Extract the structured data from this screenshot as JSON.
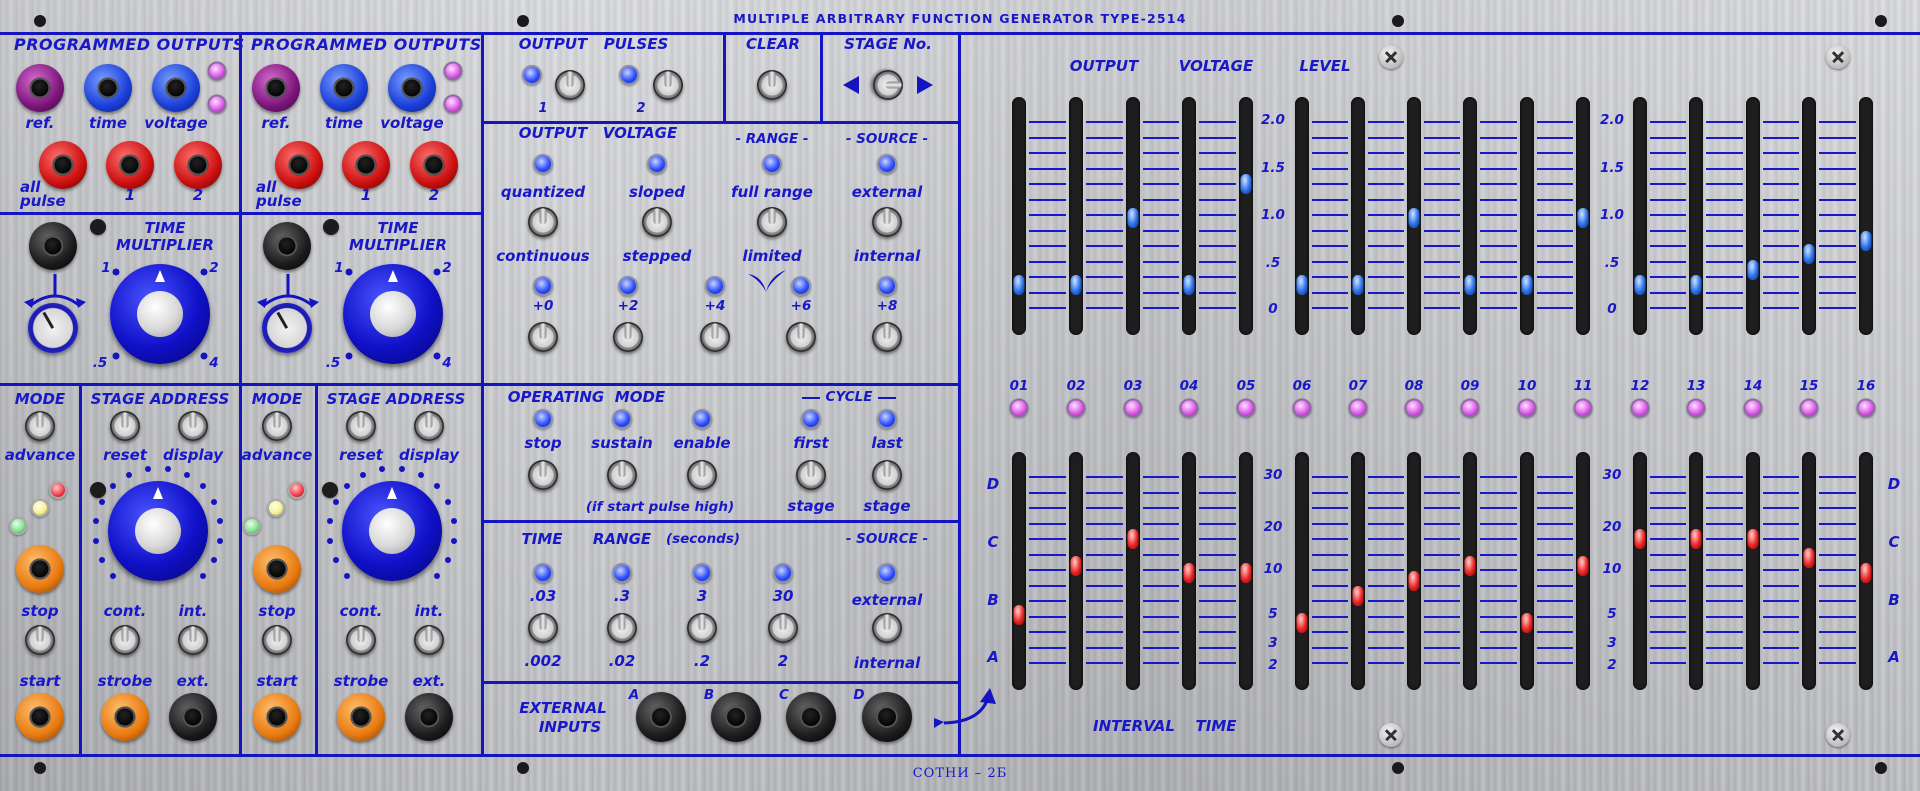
{
  "header": {
    "title": "MULTIPLE ARBITRARY FUNCTION GENERATOR TYPE-2514"
  },
  "footer": {
    "brand": "СОТНИ – 2Б"
  },
  "programmed_outputs": {
    "title": "PROGRAMMED OUTPUTS",
    "ref": "ref.",
    "time": "time",
    "voltage": "voltage",
    "all": "all",
    "pulse": "pulse",
    "one": "1",
    "two": "2"
  },
  "time_multiplier": {
    "title_line1": "TIME",
    "title_line2": "MULTIPLIER",
    "s1": "1",
    "s2": "2",
    "s5": ".5",
    "s4": "4"
  },
  "mode": {
    "title": "MODE",
    "advance": "advance",
    "stop": "stop",
    "start": "start"
  },
  "stage_address": {
    "title": "STAGE ADDRESS",
    "reset": "reset",
    "display": "display",
    "cont": "cont.",
    "int": "int.",
    "strobe": "strobe",
    "ext": "ext."
  },
  "output_pulses": {
    "output": "OUTPUT",
    "pulses": "PULSES",
    "p1": "1",
    "p2": "2"
  },
  "clear": {
    "title": "CLEAR"
  },
  "stage_no": {
    "title": "STAGE No."
  },
  "output_voltage": {
    "output": "OUTPUT",
    "voltage": "VOLTAGE",
    "range": "- RANGE -",
    "source": "- SOURCE -",
    "quantized": "quantized",
    "continuous": "continuous",
    "sloped": "sloped",
    "stepped": "stepped",
    "full_range": "full range",
    "limited": "limited",
    "external": "external",
    "internal": "internal",
    "offsets": [
      "+0",
      "+2",
      "+4",
      "+6",
      "+8"
    ]
  },
  "operating_mode": {
    "operating": "OPERATING",
    "mode": "MODE",
    "cycle": "CYCLE",
    "stop": "stop",
    "sustain": "sustain",
    "enable": "enable",
    "first": "first",
    "last": "last",
    "if_start": "(if start  pulse  high)",
    "stage1": "stage",
    "stage2": "stage"
  },
  "time_range": {
    "time": "TIME",
    "range": "RANGE",
    "seconds": "(seconds)",
    "source": "- SOURCE -",
    "tops": [
      ".03",
      ".3",
      "3",
      "30"
    ],
    "bottoms": [
      ".002",
      ".02",
      ".2",
      "2"
    ],
    "external": "external",
    "internal": "internal"
  },
  "external_inputs": {
    "line1": "EXTERNAL",
    "line2": "INPUTS",
    "a": "A",
    "b": "B",
    "c": "C",
    "d": "D"
  },
  "sliders": {
    "output_label": "OUTPUT",
    "voltage_label": "VOLTAGE",
    "level_label": "LEVEL",
    "interval_label": "INTERVAL",
    "time_label": "TIME",
    "voltage_scale": [
      "2.0",
      "1.5",
      "1.0",
      ".5",
      "0"
    ],
    "time_scale": [
      "30",
      "20",
      "10",
      "5",
      "3",
      "2"
    ],
    "letters": [
      "D",
      "C",
      "B",
      "A"
    ],
    "stages": [
      "01",
      "02",
      "03",
      "04",
      "05",
      "06",
      "07",
      "08",
      "09",
      "10",
      "11",
      "12",
      "13",
      "14",
      "15",
      "16"
    ],
    "voltage_levels_fraction": [
      0.17,
      0.17,
      0.52,
      0.17,
      0.7,
      0.17,
      0.17,
      0.52,
      0.17,
      0.17,
      0.52,
      0.17,
      0.17,
      0.25,
      0.33,
      0.4
    ],
    "time_levels_fraction": [
      0.3,
      0.56,
      0.7,
      0.52,
      0.52,
      0.26,
      0.4,
      0.48,
      0.56,
      0.26,
      0.56,
      0.7,
      0.7,
      0.7,
      0.6,
      0.52
    ]
  }
}
